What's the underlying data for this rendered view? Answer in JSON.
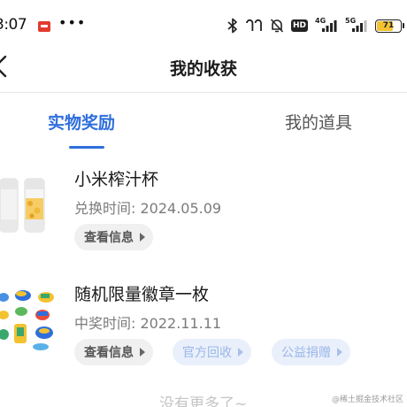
{
  "status_bar": {
    "time": "3:07",
    "more": "•••",
    "hd_label": "HD",
    "network_1": "4G",
    "network_2": "5G",
    "battery": 71,
    "battery_text": "71"
  },
  "header": {
    "title": "我的收获"
  },
  "tabs": [
    {
      "label": "实物奖励",
      "active": true
    },
    {
      "label": "我的道具",
      "active": false
    }
  ],
  "prizes": [
    {
      "name": "小米榨汁杯",
      "time": "兑换时间: 2024.05.09",
      "image_icon": "juicer-cup-image",
      "actions": [
        {
          "label": "查看信息",
          "style": "grey"
        }
      ]
    },
    {
      "name": "随机限量徽章一枚",
      "time": "中奖时间: 2022.11.11",
      "image_icon": "badge-collection-image",
      "actions": [
        {
          "label": "查看信息",
          "style": "grey"
        },
        {
          "label": "官方回收",
          "style": "blue"
        },
        {
          "label": "公益捐赠",
          "style": "blue"
        }
      ]
    }
  ],
  "footer": {
    "end_text": "没有更多了~"
  },
  "watermark": "@稀土掘金技术社区",
  "colors": {
    "accent": "#2f6fdc",
    "muted_text": "#7b7b7b",
    "pill_grey_bg": "#f0f0f0",
    "pill_blue_bg": "#eaf0fb",
    "battery": "#f2c230"
  }
}
